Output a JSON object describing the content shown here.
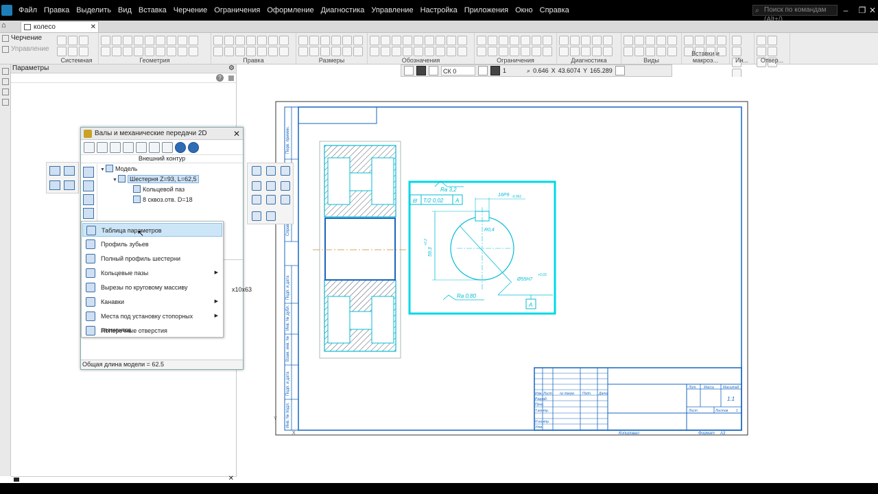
{
  "menubar": {
    "items": [
      "Файл",
      "Правка",
      "Выделить",
      "Вид",
      "Вставка",
      "Черчение",
      "Ограничения",
      "Оформление",
      "Диагностика",
      "Управление",
      "Настройка",
      "Приложения",
      "Окно",
      "Справка"
    ],
    "search_placeholder": "Поиск по командам (Alt+/)"
  },
  "tab": {
    "doc_name": "колесо зубчатое.cdw"
  },
  "ribbon": {
    "modes": [
      "Черчение",
      "Управление"
    ],
    "groups": [
      "Системная",
      "Геометрия",
      "Правка",
      "Размеры",
      "Обозначения",
      "Ограничения",
      "Диагностика",
      "Виды",
      "Вставки и макроэ...",
      "Ин...",
      "Отвер..."
    ]
  },
  "coordbar": {
    "cs_label": "СК 0",
    "layer": "1",
    "zoom": "0.646",
    "x_label": "X",
    "x_value": "43.6074",
    "y_label": "Y",
    "y_value": "165.289"
  },
  "params_panel": {
    "title": "Параметры"
  },
  "dialog": {
    "title": "Валы и механические передачи 2D",
    "subtitle": "Внешний контур",
    "tree": {
      "root": "Модель",
      "selected": "Шестерня Z=93, L=62,5",
      "children": [
        "Кольцевой паз",
        "8 сквоз.отв. D=18"
      ]
    },
    "lower_text": "x10x63",
    "status": "Общая длина модели = 62.5"
  },
  "context_menu": {
    "items": [
      {
        "label": "Таблица параметров",
        "submenu": false
      },
      {
        "label": "Профиль зубьев",
        "submenu": false
      },
      {
        "label": "Полный профиль шестерни",
        "submenu": false
      },
      {
        "label": "Кольцевые пазы",
        "submenu": true
      },
      {
        "label": "Вырезы по круговому массиву",
        "submenu": false
      },
      {
        "label": "Канавки",
        "submenu": true
      },
      {
        "label": "Места под установку стопорных элементов",
        "submenu": true
      },
      {
        "label": "Поперечные отверстия",
        "submenu": false
      }
    ]
  },
  "drawing": {
    "frame_labels": [
      "Перв. примен.",
      "Справ. №",
      "Подп. и дата",
      "Инв. № дубл.",
      "Взам. инв. №",
      "Подп. и дата",
      "Инв. № подл."
    ],
    "section": {
      "roughness_top": "Ra 3,2",
      "tolerance_flag": "Т/2 0,02",
      "datum_ref": "A",
      "keyway_dim": "16P9",
      "keyway_tol": "-0,061",
      "radius_label": "R0,4",
      "depth_dim": "59,3",
      "depth_tol": "+0,2",
      "bore_dim": "Ø55H7",
      "bore_tol": "+0,03",
      "roughness_bottom": "Ra 0,80",
      "datum_box": "A"
    },
    "titleblock": {
      "cols": [
        "Изм.",
        "Лист",
        "№ докум.",
        "Подп.",
        "Дата"
      ],
      "rows": [
        "Разраб.",
        "Пров.",
        "Т.контр.",
        "Н.контр.",
        "Утв."
      ],
      "lit_headers": [
        "Лит.",
        "Масса",
        "Масштаб"
      ],
      "scale": "1:1",
      "sheet": "Лист",
      "sheets": "Листов",
      "sheets_count": "1",
      "copied": "Копировал",
      "format": "Формат",
      "format_value": "A3"
    },
    "axis_y": "Y",
    "axis_x": "X"
  }
}
